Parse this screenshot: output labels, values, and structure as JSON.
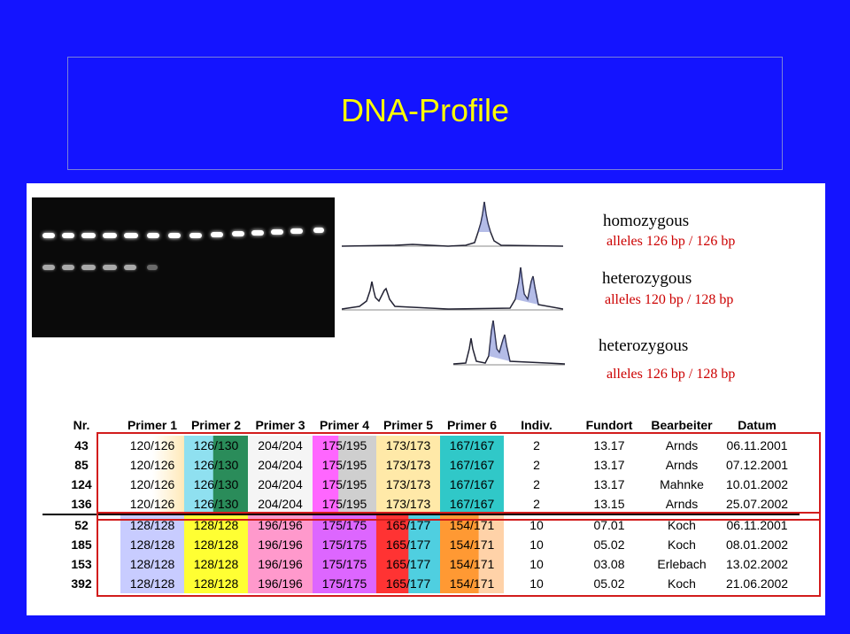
{
  "title": "DNA-Profile",
  "legend": {
    "homozygous_label": "homozygous",
    "homozygous_alleles": "alleles 126 bp / 126 bp",
    "hetero1_label": "heterozygous",
    "hetero1_alleles": "alleles 120 bp / 128 bp",
    "hetero2_label": "heterozygous",
    "hetero2_alleles": "alleles 126 bp / 128 bp"
  },
  "table": {
    "headers": [
      "Nr.",
      "Primer 1",
      "Primer 2",
      "Primer 3",
      "Primer 4",
      "Primer 5",
      "Primer 6",
      "Indiv.",
      "Fundort",
      "Bearbeiter",
      "Datum"
    ],
    "rows": [
      [
        "43",
        "120/126",
        "126/130",
        "204/204",
        "175/195",
        "173/173",
        "167/167",
        "2",
        "13.17",
        "Arnds",
        "06.11.2001"
      ],
      [
        "85",
        "120/126",
        "126/130",
        "204/204",
        "175/195",
        "173/173",
        "167/167",
        "2",
        "13.17",
        "Arnds",
        "07.12.2001"
      ],
      [
        "124",
        "120/126",
        "126/130",
        "204/204",
        "175/195",
        "173/173",
        "167/167",
        "2",
        "13.17",
        "Mahnke",
        "10.01.2002"
      ],
      [
        "136",
        "120/126",
        "126/130",
        "204/204",
        "175/195",
        "173/173",
        "167/167",
        "2",
        "13.15",
        "Arnds",
        "25.07.2002"
      ],
      [
        "52",
        "128/128",
        "128/128",
        "196/196",
        "175/175",
        "165/177",
        "154/171",
        "10",
        "07.01",
        "Koch",
        "06.11.2001"
      ],
      [
        "185",
        "128/128",
        "128/128",
        "196/196",
        "175/175",
        "165/177",
        "154/171",
        "10",
        "05.02",
        "Koch",
        "08.01.2002"
      ],
      [
        "153",
        "128/128",
        "128/128",
        "196/196",
        "175/175",
        "165/177",
        "154/171",
        "10",
        "03.08",
        "Erlebach",
        "13.02.2002"
      ],
      [
        "392",
        "128/128",
        "128/128",
        "196/196",
        "175/175",
        "165/177",
        "154/171",
        "10",
        "05.02",
        "Koch",
        "21.06.2002"
      ]
    ]
  },
  "colors": {
    "background": "#1414ff",
    "title": "#ffff00",
    "outline": "#d21c1c",
    "legend_sub": "#cc0000"
  }
}
